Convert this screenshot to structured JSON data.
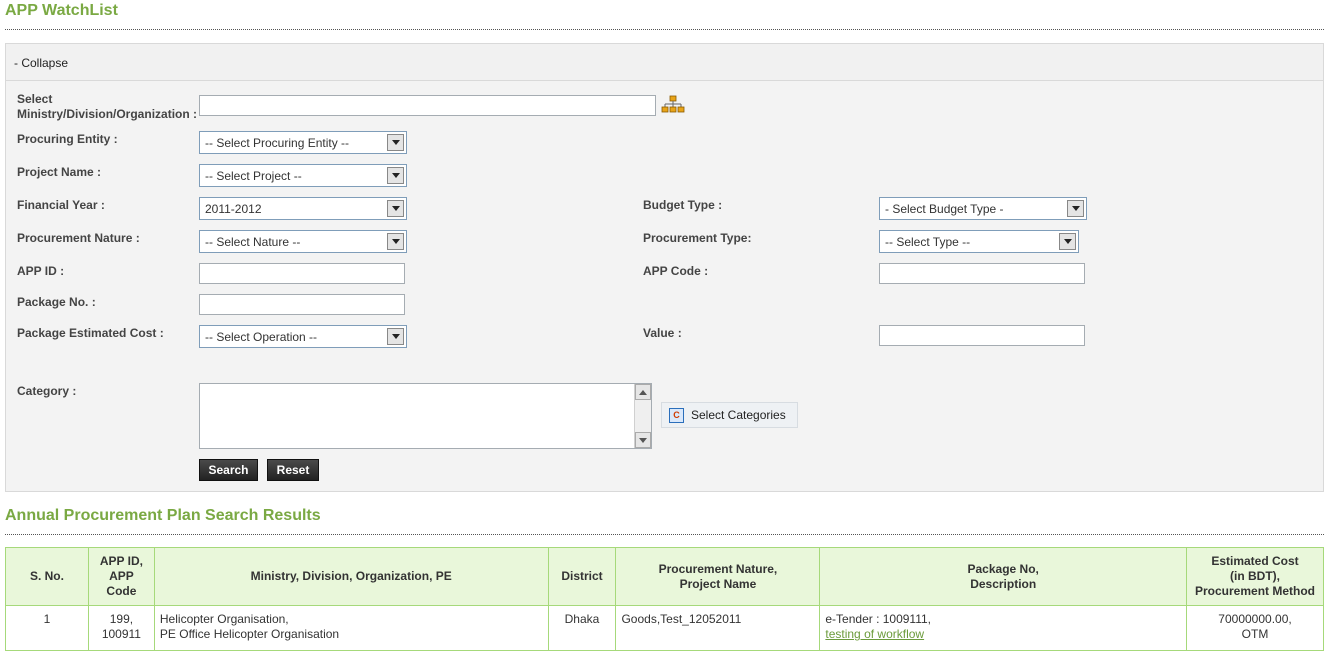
{
  "page": {
    "title": "APP WatchList"
  },
  "search_panel": {
    "collapse_label": "- Collapse",
    "fields": {
      "ministry": {
        "label_line1": "Select",
        "label_line2": "Ministry/Division/Organization :",
        "value": ""
      },
      "procuring_entity": {
        "label": "Procuring Entity :",
        "selected": "-- Select Procuring Entity --"
      },
      "project_name": {
        "label": "Project Name :",
        "selected": "-- Select Project --"
      },
      "financial_year": {
        "label": "Financial Year :",
        "selected": "2011-2012"
      },
      "budget_type": {
        "label": "Budget Type :",
        "selected": "- Select Budget Type -"
      },
      "procurement_nature": {
        "label": "Procurement Nature :",
        "selected": "-- Select Nature --"
      },
      "procurement_type": {
        "label": "Procurement Type:",
        "selected": "-- Select Type --"
      },
      "app_id": {
        "label": "APP ID :",
        "value": ""
      },
      "app_code": {
        "label": "APP Code :",
        "value": ""
      },
      "package_no": {
        "label": "Package No. :",
        "value": ""
      },
      "package_estimated_cost": {
        "label": "Package Estimated Cost :",
        "selected": "-- Select Operation --"
      },
      "value": {
        "label": "Value :",
        "value": ""
      },
      "category": {
        "label": "Category :",
        "value": ""
      }
    },
    "select_categories_label": "Select Categories",
    "search_label": "Search",
    "reset_label": "Reset"
  },
  "results": {
    "title": "Annual Procurement Plan Search Results",
    "columns": {
      "sno": "S. No.",
      "app_id_l1": "APP ID,",
      "app_id_l2": "APP Code",
      "ministry": "Ministry, Division, Organization, PE",
      "district": "District",
      "nature_l1": "Procurement Nature,",
      "nature_l2": "Project Name",
      "package_l1": "Package No,",
      "package_l2": "Description",
      "cost_l1": "Estimated Cost",
      "cost_l2": "(in BDT),",
      "cost_l3": "Procurement Method"
    },
    "rows": [
      {
        "sno": "1",
        "app_id": "199,",
        "app_code": "100911",
        "ministry_l1": "Helicopter Organisation,",
        "ministry_l2": "PE Office Helicopter Organisation",
        "district": "Dhaka",
        "nature_project": "Goods,Test_12052011",
        "package_no": "e-Tender : 1009111,",
        "description": "testing of workflow",
        "estimated_cost": "70000000.00,",
        "method": "OTM"
      }
    ]
  },
  "colors": {
    "accent_green": "#7aa943",
    "table_border": "#a6d97a",
    "header_bg": "#e9f7da"
  }
}
